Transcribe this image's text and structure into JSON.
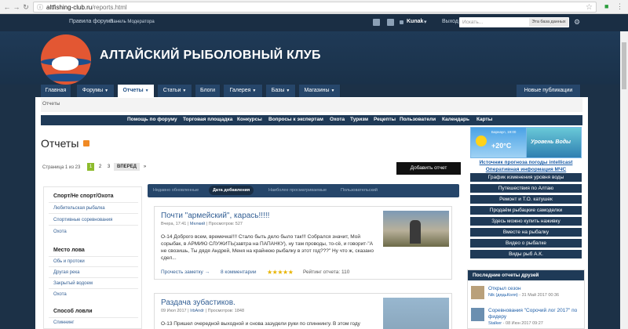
{
  "browser": {
    "url_host": "altfishing-club.ru",
    "url_path": "/reports.html"
  },
  "topbar": {
    "rules": "Правила форума",
    "moderator_panel": "Панель Модератора",
    "user": "Kunak",
    "logout": "Выход",
    "search_placeholder": "Искать...",
    "search_scope": "Эта база данных"
  },
  "site": {
    "title": "АЛТАЙСКИЙ РЫБОЛОВНЫЙ КЛУБ"
  },
  "mainnav": {
    "tabs": [
      {
        "label": "Главная"
      },
      {
        "label": "Форумы"
      },
      {
        "label": "Отчеты"
      },
      {
        "label": "Статьи"
      },
      {
        "label": "Блоги"
      },
      {
        "label": "Галерея"
      },
      {
        "label": "Базы"
      },
      {
        "label": "Магазины"
      }
    ],
    "new_posts": "Новые публикации"
  },
  "breadcrumb": "Отчеты",
  "secnav": [
    "Помощь по форуму",
    "Торговая площадка",
    "Конкурсы",
    "Вопросы к экспертам",
    "Охота",
    "Туризм",
    "Рецепты",
    "Пользователи",
    "Календарь",
    "Карты"
  ],
  "page": {
    "title": "Отчеты",
    "pager_label": "Страница 1 из 23",
    "pages": [
      "1",
      "2",
      "3"
    ],
    "next": "ВПЕРЕД",
    "next_arrow": "»",
    "add_report": "Добавить отчет"
  },
  "filters": {
    "sections": [
      {
        "title": "Спорт/Не спорт/Охота",
        "items": [
          "Любительская рыбалка",
          "Спортивные соревнования",
          "Охота"
        ]
      },
      {
        "title": "Место лова",
        "items": [
          "Обь и протоки",
          "Другая река",
          "Закрытый водоем",
          "Охота"
        ]
      },
      {
        "title": "Способ ловли",
        "items": [
          "Спиннинг"
        ]
      }
    ]
  },
  "content_tabs": [
    "Недавно обновленные",
    "Дата добавления",
    "Наиболее просматриваемые",
    "Пользовательский"
  ],
  "posts": [
    {
      "title": "Почти \"армейский\", карась!!!!!",
      "date": "Вчера, 17:41",
      "author": "Мелкий",
      "views": "Просмотров: 527",
      "text": "О-14 Доброго всем, времечка!!!! Стало быть дело было так!!! Собрался значит, Мой сорыбак, в АРМИЮ СЛУЖИТЬ(завтра на ПАПАНКУ), ну там проводы, то-сё, и говорит-\"А не свозишь, Ты дядя Андрей, Меня на крайнюю рыбалку в этот год???\" Ну что ж, сказано сдел...",
      "read_more": "Прочесть заметку →",
      "comments": "8 комментарии",
      "stars": "★★★★★",
      "rating": "Рейтинг отчета: 110"
    },
    {
      "title": "Раздача зубастиков.",
      "date": "09 Июл 2017",
      "author": "IrbAndr",
      "views": "Просмотров: 1848",
      "text": "О-13 Пришел очередной выходной и снова заэудели руки по спиннингу. В этом году"
    }
  ],
  "weather": {
    "city": "Барнаул, 19:00",
    "temp": "+20°C",
    "level_label": "Уровень Воды"
  },
  "right_links": [
    "Источник прогноза погоды intellicast",
    "Оперативная информация МЧС"
  ],
  "right_menu": [
    "График изменения уровня воды",
    "Путешествия по Алтаю",
    "Ремонт и Т.О. катушек",
    "Продаём рыбацкие самоделки",
    "Здесь можно купить наживку",
    "Вместе на рыбалку",
    "Видео о рыбалке",
    "Виды рыб А.К."
  ],
  "friends": {
    "title": "Последние отчеты друзей",
    "items": [
      {
        "title": "Открыл сезон",
        "author": "Nik (дядьКоля)",
        "date": " - 31 Май 2017 00:36"
      },
      {
        "title": "Соревнования \"Сорочий лог 2017\" по фидеру",
        "author": "Stalker",
        "date": " - 08 Июн 2017 09:27"
      }
    ]
  }
}
